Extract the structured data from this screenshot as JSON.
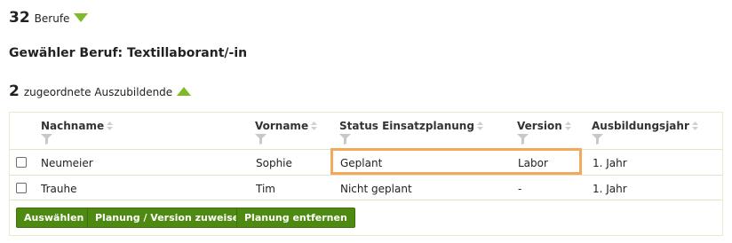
{
  "header": {
    "count": "32",
    "count_label": "Berufe",
    "selected_title": "Gewähler Beruf: Textillaborant/-in"
  },
  "assigned": {
    "count": "2",
    "label": "zugeordnete Auszubildende"
  },
  "table": {
    "columns": [
      "Nachname",
      "Vorname",
      "Status Einsatzplanung",
      "Version",
      "Ausbildungsjahr"
    ],
    "rows": [
      {
        "nachname": "Neumeier",
        "vorname": "Sophie",
        "status": "Geplant",
        "version": "Labor",
        "jahr": "1. Jahr",
        "checked": false
      },
      {
        "nachname": "Trauhe",
        "vorname": "Tim",
        "status": "Nicht geplant",
        "version": "-",
        "jahr": "1. Jahr",
        "checked": false
      }
    ]
  },
  "buttons": {
    "select": "Auswählen",
    "assign": "Planung / Version zuweisen",
    "remove": "Planung entfernen"
  },
  "colors": {
    "accent_green": "#7dbb2a",
    "button_green": "#4e8a12",
    "highlight_orange": "#f2a95c"
  },
  "icons": {
    "collapse_berufe": "triangle-down-icon",
    "expand_assigned": "triangle-up-icon",
    "sort": "sort-icon",
    "filter": "funnel-icon"
  }
}
